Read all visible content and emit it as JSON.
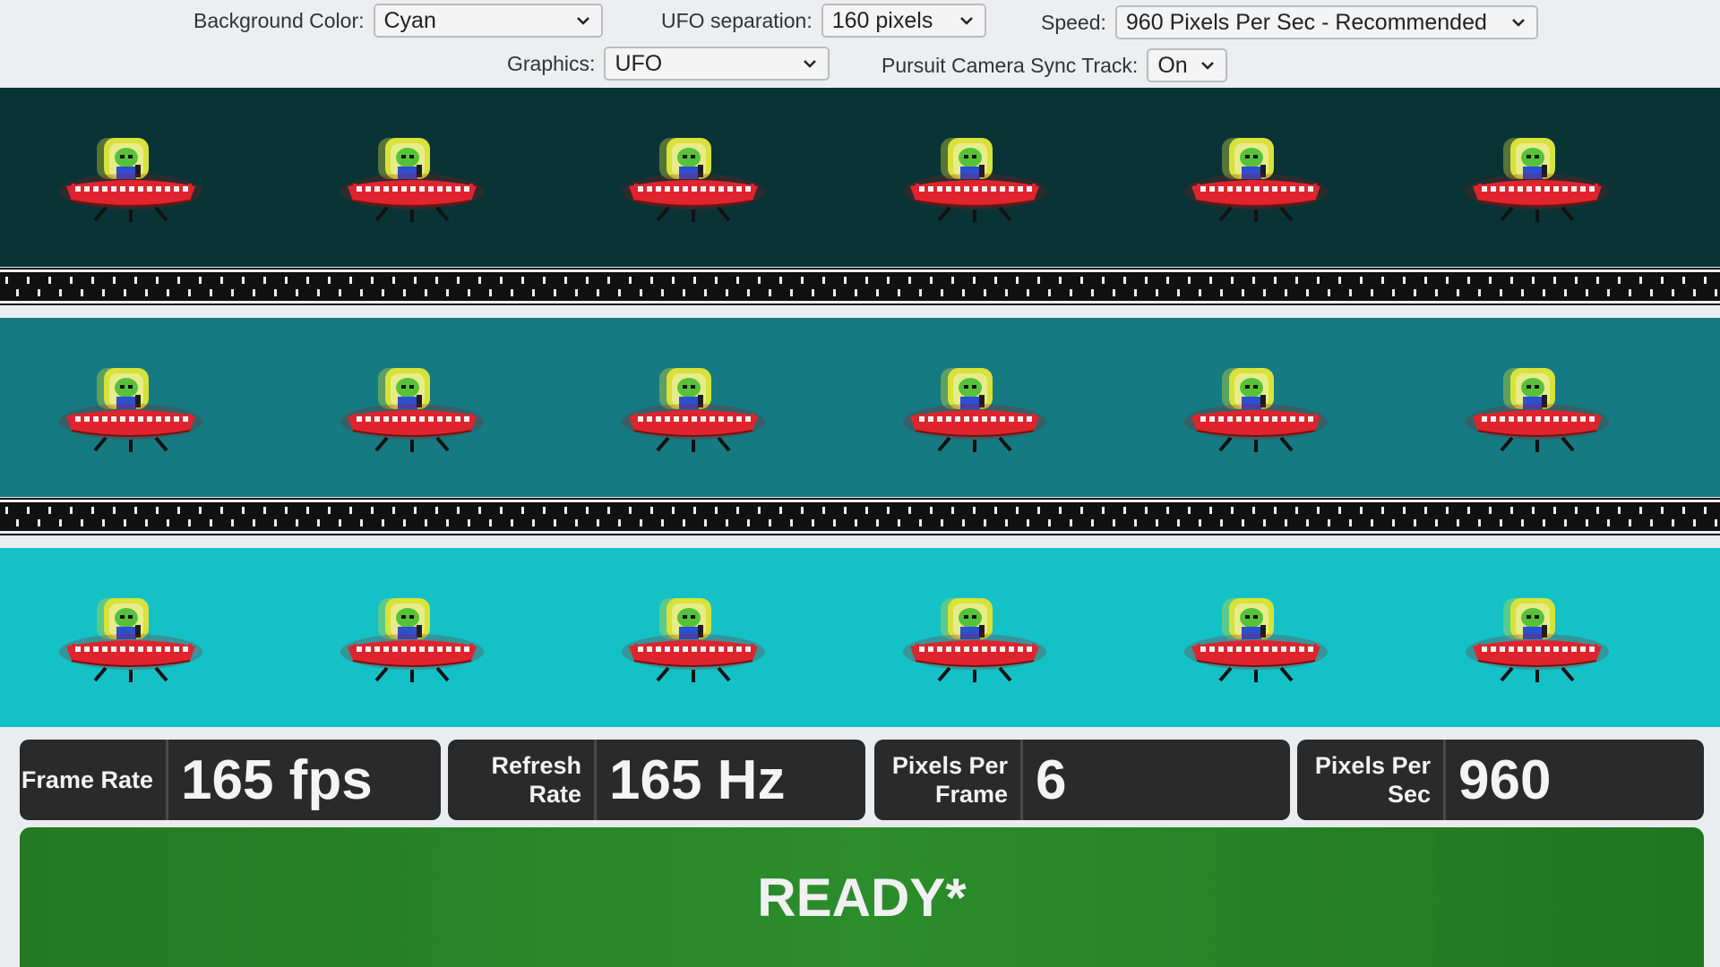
{
  "controls": {
    "background_color": {
      "label": "Background Color:",
      "value": "Cyan"
    },
    "ufo_separation": {
      "label": "UFO separation:",
      "value": "160 pixels"
    },
    "speed": {
      "label": "Speed:",
      "value": "960 Pixels Per Sec - Recommended"
    },
    "graphics": {
      "label": "Graphics:",
      "value": "UFO"
    },
    "pursuit_camera": {
      "label": "Pursuit Camera Sync Track:",
      "value": "On"
    }
  },
  "bands": [
    {
      "color": "#0a3336",
      "ufo_count": 6
    },
    {
      "color": "#167a82",
      "ufo_count": 6
    },
    {
      "color": "#13c1c6",
      "ufo_count": 6
    }
  ],
  "stats": {
    "frame_rate": {
      "label": "Frame Rate",
      "value": "165 fps"
    },
    "refresh_rate": {
      "label": "Refresh Rate",
      "value": "165 Hz"
    },
    "pixels_per_frame": {
      "label": "Pixels Per Frame",
      "value": "6"
    },
    "pixels_per_sec": {
      "label": "Pixels Per Sec",
      "value": "960"
    }
  },
  "status": {
    "text": "READY*",
    "color": "#2a8a2a"
  }
}
